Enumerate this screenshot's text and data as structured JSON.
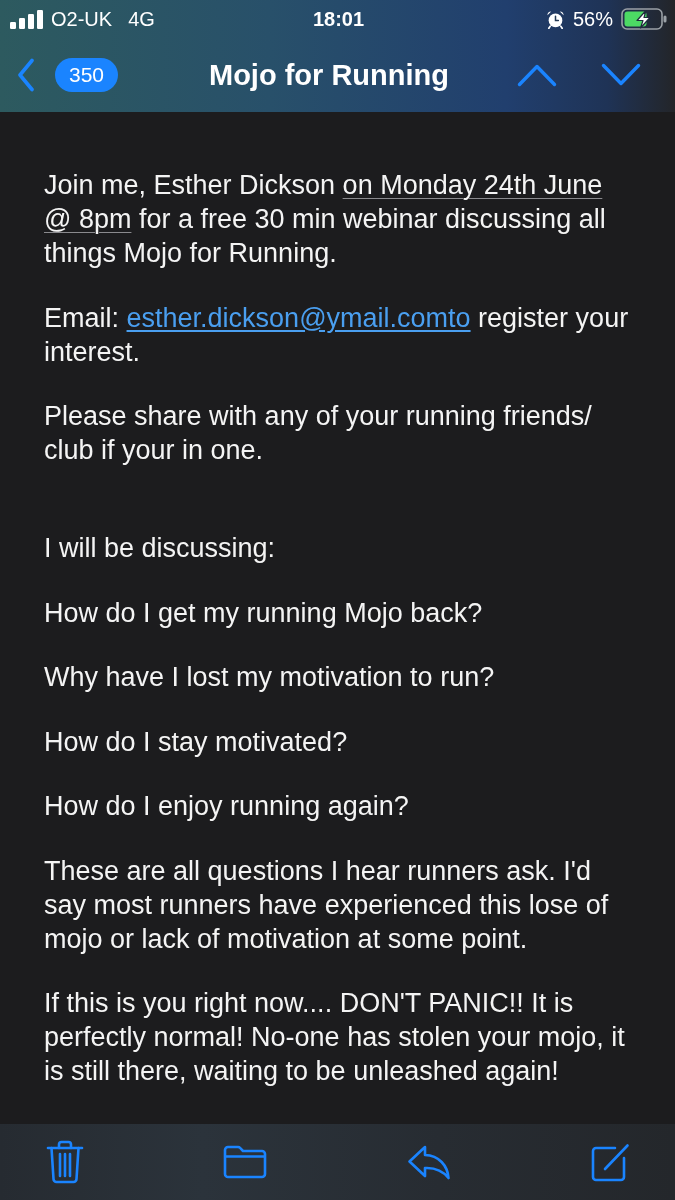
{
  "status_bar": {
    "carrier": "O2-UK",
    "network": "4G",
    "time": "18:01",
    "battery_percent": "56%"
  },
  "nav_bar": {
    "unread_count": "350",
    "title": "Mojo for Running"
  },
  "message": {
    "paragraphs": [
      {
        "kind": "text",
        "segments": [
          {
            "kind": "plain",
            "text": "Join me, Esther Dickson "
          },
          {
            "kind": "date",
            "text": "on Monday 24th June @ 8pm"
          },
          {
            "kind": "plain",
            "text": " for a free 30 min webinar discussing all things Mojo for Running."
          }
        ]
      },
      {
        "kind": "text",
        "segments": [
          {
            "kind": "plain",
            "text": "Email: "
          },
          {
            "kind": "email",
            "text": "esther.dickson@ymail.comto"
          },
          {
            "kind": "plain",
            "text": " register your interest."
          }
        ]
      },
      {
        "kind": "text",
        "segments": [
          {
            "kind": "plain",
            "text": "Please share with any of your running friends/ club if your in one."
          }
        ]
      },
      {
        "kind": "blank"
      },
      {
        "kind": "text",
        "segments": [
          {
            "kind": "plain",
            "text": "I will be discussing:"
          }
        ]
      },
      {
        "kind": "text",
        "segments": [
          {
            "kind": "plain",
            "text": "How do I get my running Mojo back?"
          }
        ]
      },
      {
        "kind": "text",
        "segments": [
          {
            "kind": "plain",
            "text": "Why have I lost my motivation to run?"
          }
        ]
      },
      {
        "kind": "text",
        "segments": [
          {
            "kind": "plain",
            "text": "How do I stay motivated?"
          }
        ]
      },
      {
        "kind": "text",
        "segments": [
          {
            "kind": "plain",
            "text": "How do I enjoy running again?"
          }
        ]
      },
      {
        "kind": "text",
        "segments": [
          {
            "kind": "plain",
            "text": "These are all questions I hear runners ask. I'd say most runners have experienced this lose of mojo or lack of motivation at some point."
          }
        ]
      },
      {
        "kind": "text",
        "segments": [
          {
            "kind": "plain",
            "text": "If this is you right now.... DON'T PANIC!! It is perfectly normal! No-one has stolen your mojo, it is still there, waiting to be unleashed again!"
          }
        ]
      }
    ]
  }
}
